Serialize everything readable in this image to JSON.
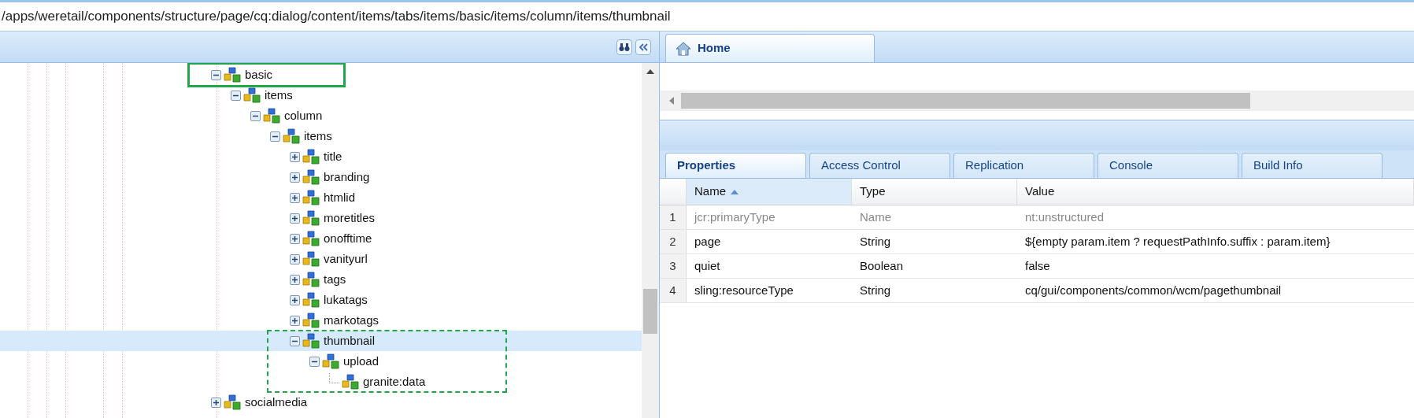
{
  "path_bar": {
    "value": "/apps/weretail/components/structure/page/cq:dialog/content/items/tabs/items/basic/items/column/items/thumbnail"
  },
  "tree": {
    "nodes": [
      {
        "label": "basic",
        "expanded": true,
        "selected": false,
        "framed_row": true,
        "children": [
          {
            "label": "items",
            "expanded": true,
            "selected": false,
            "children": [
              {
                "label": "column",
                "expanded": true,
                "selected": false,
                "children": [
                  {
                    "label": "items",
                    "expanded": true,
                    "selected": false,
                    "children": [
                      {
                        "label": "title",
                        "expanded": false,
                        "selected": false
                      },
                      {
                        "label": "branding",
                        "expanded": false,
                        "selected": false
                      },
                      {
                        "label": "htmlid",
                        "expanded": false,
                        "selected": false
                      },
                      {
                        "label": "moretitles",
                        "expanded": false,
                        "selected": false
                      },
                      {
                        "label": "onofftime",
                        "expanded": false,
                        "selected": false
                      },
                      {
                        "label": "vanityurl",
                        "expanded": false,
                        "selected": false
                      },
                      {
                        "label": "tags",
                        "expanded": false,
                        "selected": false
                      },
                      {
                        "label": "lukatags",
                        "expanded": false,
                        "selected": false
                      },
                      {
                        "label": "markotags",
                        "expanded": false,
                        "selected": false
                      },
                      {
                        "label": "thumbnail",
                        "expanded": true,
                        "selected": true,
                        "framed_group": true,
                        "children": [
                          {
                            "label": "upload",
                            "expanded": true,
                            "selected": false,
                            "children": [
                              {
                                "label": "granite:data",
                                "kind": "leaf",
                                "selected": false
                              }
                            ]
                          }
                        ]
                      }
                    ]
                  }
                ]
              }
            ]
          }
        ]
      },
      {
        "label": "socialmedia",
        "expanded": false,
        "selected": false
      }
    ]
  },
  "editor_tabs": [
    {
      "label": "Home",
      "selected": true
    }
  ],
  "property_tabs": [
    {
      "label": "Properties",
      "selected": true
    },
    {
      "label": "Access Control",
      "selected": false
    },
    {
      "label": "Replication",
      "selected": false
    },
    {
      "label": "Console",
      "selected": false
    },
    {
      "label": "Build Info",
      "selected": false
    }
  ],
  "properties": {
    "columns": [
      {
        "label": "Name",
        "sorted_ascending": true
      },
      {
        "label": "Type"
      },
      {
        "label": "Value"
      }
    ],
    "rows": [
      {
        "number": "1",
        "name": "jcr:primaryType",
        "type": "Name",
        "value": "nt:unstructured",
        "protected": true
      },
      {
        "number": "2",
        "name": "page",
        "type": "String",
        "value": "${empty param.item ? requestPathInfo.suffix : param.item}",
        "protected": false
      },
      {
        "number": "3",
        "name": "quiet",
        "type": "Boolean",
        "value": "false",
        "protected": false
      },
      {
        "number": "4",
        "name": "sling:resourceType",
        "type": "String",
        "value": "cq/gui/components/common/wcm/pagethumbnail",
        "protected": false
      }
    ]
  }
}
